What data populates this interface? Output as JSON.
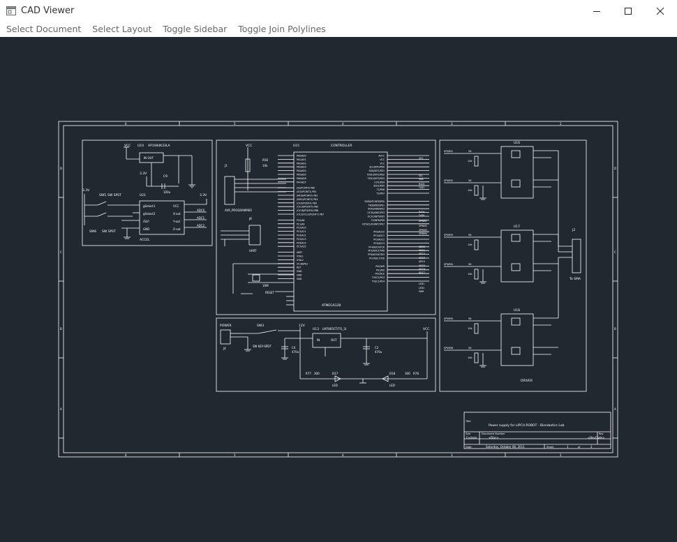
{
  "window": {
    "title": "CAD Viewer",
    "icon": "app-window-icon",
    "controls": [
      "minimize-icon",
      "maximize-icon",
      "close-icon"
    ]
  },
  "menu": {
    "items": [
      {
        "label": "Select Document"
      },
      {
        "label": "Select Layout"
      },
      {
        "label": "Toggle Sidebar"
      },
      {
        "label": "Toggle Join Polylines"
      }
    ]
  },
  "drawing": {
    "background": "#212830",
    "stroke": "#ffffff",
    "border_cols": [
      "6",
      "5",
      "4",
      "3",
      "2",
      "1"
    ],
    "border_rows": [
      "D",
      "C",
      "B",
      "A"
    ],
    "blocks": {
      "accel": {
        "vcc": "VCC",
        "reg_ref": "U10",
        "reg_part": "AP1084K33LA",
        "reg_pins": "IN      OUT",
        "v33": "3.3V",
        "cap_ref": "C9",
        "cap_val": "100u",
        "v33b": "3.3V",
        "sw5": "SW5",
        "sw5_type": "SW SPST",
        "sw6": "SW6",
        "sw6_type": "SW SPST",
        "u21": "U21",
        "v33c": "3.3V",
        "pins_left": [
          "gSelect1",
          "gSelect2",
          "/SLP",
          "GND"
        ],
        "pins_right": [
          "VCC",
          "X-out",
          "Y-out",
          "Z-out"
        ],
        "nets": [
          "ADC0",
          "ADC1",
          "ADC2"
        ],
        "label": "ACCEL"
      },
      "controller": {
        "u_ref": "U15",
        "title": "CONTROLLER",
        "vcc": "VCC",
        "r_ref": "R58",
        "r_val": "10k",
        "j1": "J1",
        "prog": "AVR_PROGRAMMER",
        "j8": "J8",
        "uart": "UART",
        "xtal": "Y1",
        "xtal_val": "16M",
        "reset": "RESET",
        "chip": "ATMEGA128",
        "left_pins": [
          "PA0/AD0",
          "PA1/AD1",
          "PA2/AD2",
          "PA3/AD3",
          "PA4/AD4",
          "PA5/AD5",
          "PA6/AD6",
          "PA7/AD7"
        ],
        "left_pins2": [
          "(SS/PCINT0) PB0",
          "(SCK/PCINT1) PB1",
          "(MOSI/PCINT2) PB2",
          "(MISO/PCINT3) PB3",
          "(OC0/PCINT4) PB4",
          "(OC1A/PCINT5) PB5",
          "(OC1B/PCINT6) PB6",
          "(OC2/OC1C/PCINT7) PB7"
        ],
        "left_pins3": [
          "PC0/A8",
          "PC1/A9",
          "PC2/A10",
          "PC3/A11",
          "PC4/A12",
          "PC5/A13",
          "PC6/A14",
          "PC7/A15"
        ],
        "left_pins4": [
          "AREF",
          "XTAL1",
          "XTAL2",
          "OC3B/PE3",
          "RST",
          "GND",
          "GND",
          "GND"
        ],
        "right_pins": [
          "AVCC",
          "VCC",
          "VCC",
          "SCL/INT0/PD0",
          "SDA/INT1/PD1",
          "RXD1/INT2/PD2",
          "TXD1/INT3/PD3",
          "ICP1/PD4",
          "XCK1/PD5",
          "T1/PD6",
          "T2/PD7"
        ],
        "right_pins2": [
          "RXD0/PCINT8/PE0",
          "TXD0/PDO/PE1",
          "XCK0/AIN0/PE2",
          "OC3A/AIN1/PE3",
          "OC3C/INT5/PE5",
          "T3/INT6/PE6",
          "ICP3/CLKO/INT7/PE7"
        ],
        "right_pins3": [
          "PF0/ADC0",
          "PF1/ADC1",
          "PF2/ADC2",
          "PF3/ADC3",
          "PF4/ADC4/TCK",
          "PF5/ADC5/TMS",
          "PF6/ADC6/TDO",
          "PF7/ADC7/TDI"
        ],
        "right_pins4": [
          "PG0/WR",
          "PG1/RD",
          "PG2/ALE",
          "TOSC2/PG3",
          "TOSC1/PG4"
        ],
        "nets_right": [
          "VCC",
          "SCL",
          "SDA",
          "RxD1",
          "TxD1",
          "RxD0",
          "TxD0",
          "SPWM1",
          "SPWM2",
          "SPWM3",
          "SPWM4",
          "ADC0",
          "ADC1",
          "ADC2",
          "ADC3",
          "ADC4",
          "ADC5",
          "ADC6",
          "ADC7",
          "LED1",
          "LED2",
          "PWR"
        ]
      },
      "power": {
        "label": "POWER",
        "j4": "J4",
        "sw3": "SW3",
        "sw_type": "SW KEY-SPDT",
        "v12": "12V",
        "u_ref": "U13",
        "u_part": "LM7805CT(TO_3)",
        "u_in": "IN",
        "u_out": "OUT",
        "vcc": "VCC",
        "c4": "C4",
        "c4_val": "470u",
        "c2": "C2",
        "c2_val": "470u",
        "r77": "R77",
        "r77_val": "300",
        "d17": "D17",
        "d17_val": "LED",
        "d18": "D18",
        "d18_val": "LED",
        "r78": "300",
        "r78_ref": "R78"
      },
      "driver": {
        "label": "DRIVER",
        "j2": "J2",
        "j2_label": "To SMA",
        "u_refs": [
          "U16",
          "U17",
          "U18"
        ],
        "spwm": [
          "SPWM1",
          "SPWM2",
          "SPWM3",
          "SPWM4",
          "SPWM5",
          "SPWM6"
        ],
        "r_vals": [
          "56",
          "56",
          "56",
          "56",
          "56",
          "56"
        ],
        "r_refs": [
          "R79",
          "R80",
          "R81",
          "R82",
          "R83",
          "R84",
          "R85",
          "R86",
          "R87",
          "R88"
        ],
        "r10k": "10k"
      }
    },
    "title_block": {
      "title_label": "Title",
      "title": "Power supply for LIPCH ROBOT - Biorobotics Lab",
      "size_label": "Size",
      "doc_label": "Document Number",
      "rev_label": "Rev",
      "size": "Custom",
      "doc": "<Doc>",
      "rev": "<RevCode>",
      "date_label": "Date:",
      "date": "Saturday, October 08, 2011",
      "sheet_label": "Sheet",
      "sheet": "1",
      "of_label": "of",
      "of": "2"
    }
  }
}
